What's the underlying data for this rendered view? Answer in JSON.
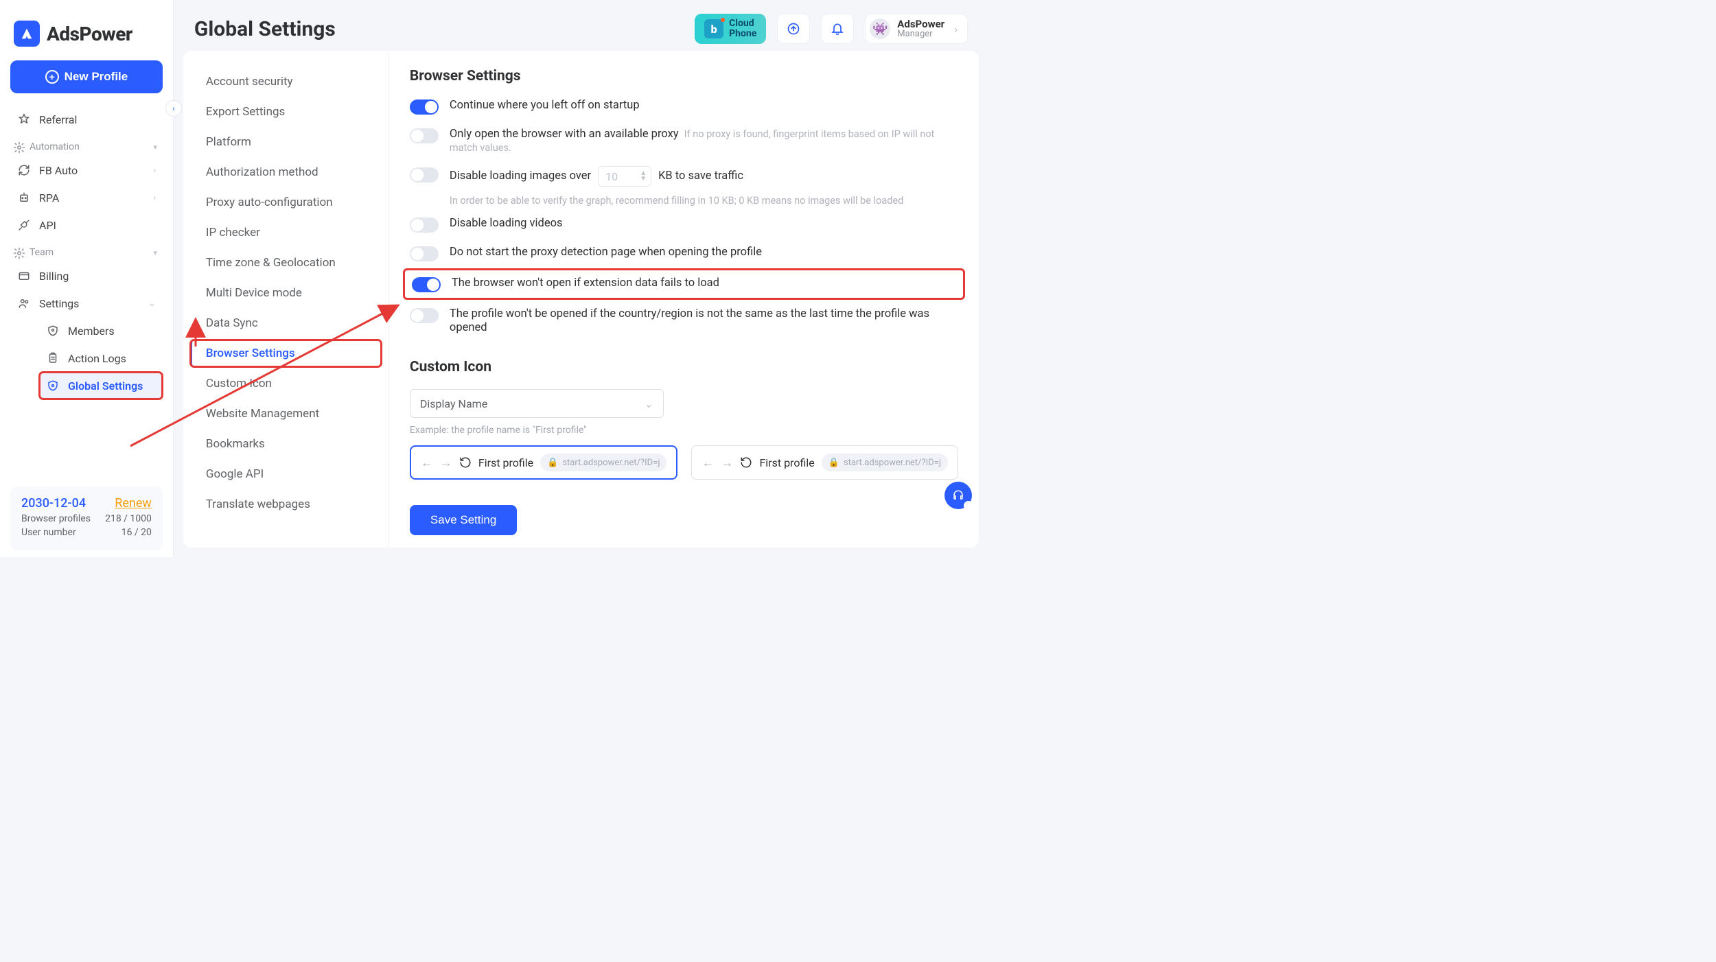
{
  "brand": {
    "name": "AdsPower"
  },
  "sidebar": {
    "new_profile": "New Profile",
    "referral": "Referral",
    "sections": {
      "automation": "Automation",
      "team": "Team"
    },
    "automation_items": {
      "fb_auto": "FB Auto",
      "rpa": "RPA",
      "api": "API"
    },
    "team_items": {
      "billing": "Billing",
      "settings": "Settings",
      "members": "Members",
      "action_logs": "Action Logs",
      "global_settings": "Global Settings"
    }
  },
  "footer": {
    "date": "2030-12-04",
    "renew": "Renew",
    "profiles_label": "Browser profiles",
    "profiles_value": "218 / 1000",
    "users_label": "User number",
    "users_value": "16 / 20"
  },
  "header": {
    "title": "Global Settings",
    "cloud_phone_l1": "Cloud",
    "cloud_phone_l2": "Phone",
    "user_name": "AdsPower",
    "user_role": "Manager"
  },
  "settings_nav": [
    "Account security",
    "Export Settings",
    "Platform",
    "Authorization method",
    "Proxy auto-configuration",
    "IP checker",
    "Time zone & Geolocation",
    "Multi Device mode",
    "Data Sync",
    "Browser Settings",
    "Custom Icon",
    "Website Management",
    "Bookmarks",
    "Google API",
    "Translate webpages"
  ],
  "browser_settings": {
    "title": "Browser Settings",
    "s1": "Continue where you left off on startup",
    "s2": "Only open the browser with an available proxy",
    "s2_hint": "If no proxy is found, fingerprint items based on IP will not match values.",
    "s3_pre": "Disable loading images over",
    "s3_kb": "10",
    "s3_post": "KB to save traffic",
    "s3_hint": "In order to be able to verify the graph, recommend filling in 10 KB; 0 KB means no images will be loaded",
    "s4": "Disable loading videos",
    "s5": "Do not start the proxy detection page when opening the profile",
    "s6": "The browser won't open if extension data fails to load",
    "s7": "The profile won't be opened if the country/region is not the same as the last time the profile was opened"
  },
  "custom_icon": {
    "title": "Custom Icon",
    "select_value": "Display Name",
    "example": "Example: the profile name is \"First profile\"",
    "preview_title": "First profile",
    "preview_url": "start.adspower.net/?ID=j"
  },
  "save_button": "Save Setting"
}
